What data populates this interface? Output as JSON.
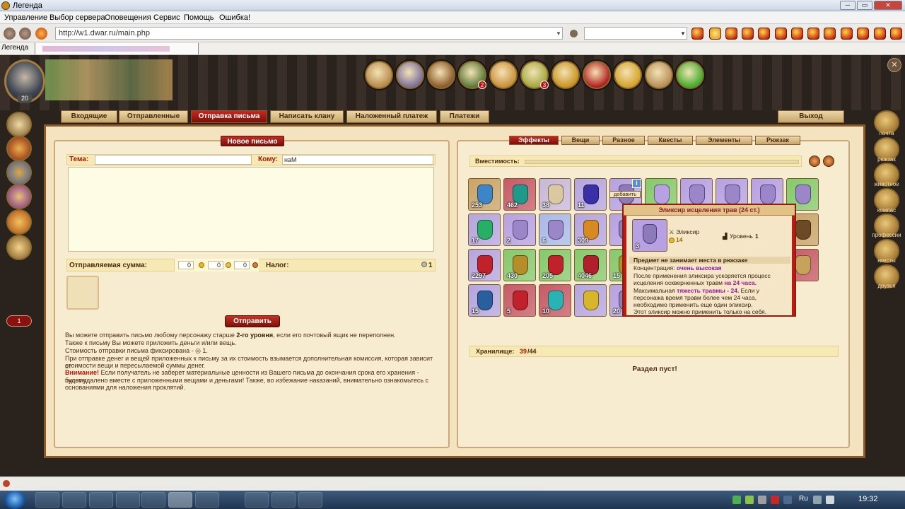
{
  "window": {
    "title": "Легенда",
    "controls": [
      "─",
      "▭",
      "✕"
    ]
  },
  "menu": [
    "Управление",
    "Выбор сервера",
    "Оповещения",
    "Сервис",
    "Помощь",
    "Ошибка!"
  ],
  "address": {
    "url": "http://w1.dwar.ru/main.php"
  },
  "browser_tab": {
    "label": "Легенда"
  },
  "hud": {
    "level": "20",
    "buttons": [
      {
        "name": "arena-icon",
        "color": "#b98a4c"
      },
      {
        "name": "castle-icon",
        "color": "#7b6f9e"
      },
      {
        "name": "bear-icon",
        "color": "#8c5b2b"
      },
      {
        "name": "warrior-icon",
        "color": "#5a7a3a",
        "badge": "2"
      },
      {
        "name": "amulet-icon",
        "color": "#c99038"
      },
      {
        "name": "map-icon",
        "color": "#a2a83e",
        "badge": "3"
      },
      {
        "name": "cards-icon",
        "color": "#c7941f"
      },
      {
        "name": "clan-emblem-icon",
        "color": "#b21e1e"
      },
      {
        "name": "gold-coins-icon",
        "color": "#d3a228"
      },
      {
        "name": "hammer-icon",
        "color": "#b88e5a"
      },
      {
        "name": "help-icon",
        "color": "#3fae2a"
      }
    ]
  },
  "right_sidebar": [
    "почта",
    "рюкзак",
    "животное",
    "компас",
    "профессии",
    "квесты",
    "друзья"
  ],
  "left_sidebar": {
    "badge": "1"
  },
  "mail_tabs": {
    "items": [
      "Входящие",
      "Отправленные",
      "Отправка письма",
      "Написать клану",
      "Наложенный платеж",
      "Платежи"
    ],
    "active": 2,
    "exit": "Выход"
  },
  "compose": {
    "header": "Новое письмо",
    "subject_label": "Тема:",
    "subject_value": "",
    "to_label": "Кому:",
    "to_value": "наМ",
    "amount_label": "Отправляемая сумма:",
    "amounts": [
      "0",
      "0",
      "0"
    ],
    "tax_label": "Налог:",
    "tax_value": "1",
    "send_button": "Отправить",
    "info": {
      "l1_pre": "Вы можете отправить письмо любому персонажу старше ",
      "l1_bold": "2-го уровня",
      "l1_post": ", если его почтовый ящик не переполнен.",
      "l2": "Также к письму Вы можете приложить деньги и/или вещь.",
      "l3": "Стоимость отправки письма фиксирована - ◎ 1.",
      "l4": "При отправке денег и вещей приложенных к письму за их стоимость взымается дополнительная комиссия, которая зависит от",
      "l5": "стоимости вещи и пересылаемой суммы денег.",
      "warn": "Внимание!",
      "l6": " Если получатель не заберет материальные ценности из Вашего письма до окончания срока его хранения - письмо",
      "l7": "будет удалено вместе с приложенными вещами и деньгами! Также, во избежание наказаний, внимательно ознакомьтесь с",
      "l8": "основаниями для наложения проклятий."
    }
  },
  "inventory": {
    "tabs": [
      "Эффекты",
      "Вещи",
      "Разное",
      "Квесты",
      "Элементы",
      "Рюкзак"
    ],
    "active": 0,
    "capacity_label": "Вместимость:",
    "storage_label": "Хранилище:",
    "storage_used": "39",
    "storage_total": "/44",
    "empty": "Раздел пуст!",
    "grid": [
      {
        "count": "253",
        "bg": "#c9a466",
        "fg": "#3d85c6"
      },
      {
        "count": "462",
        "bg": "#c75a66",
        "fg": "#1f9a8a"
      },
      {
        "count": "38",
        "bg": "#c9b8d8",
        "fg": "#d9c8a0"
      },
      {
        "count": "11",
        "bg": "#b5a5de",
        "fg": "#3b2fa8"
      },
      {
        "count": "",
        "bg": "#b7a1e2",
        "fg": "#8d7ab8"
      },
      {
        "count": "",
        "bg": "#86c96a",
        "fg": "#b7a1e2"
      },
      {
        "count": "",
        "bg": "#b7a1e2",
        "fg": "#9a86c8"
      },
      {
        "count": "",
        "bg": "#b7a1e2",
        "fg": "#9a86c8"
      },
      {
        "count": "",
        "bg": "#b7a1e2",
        "fg": "#9a86c8"
      },
      {
        "count": "",
        "bg": "#86c96a",
        "fg": "#9a86c8"
      },
      {
        "count": "17",
        "bg": "#b5a5de",
        "fg": "#27b065"
      },
      {
        "count": "2",
        "bg": "#b7a1e2",
        "fg": "#9a86c8"
      },
      {
        "count": "6",
        "bg": "#a9b9e8",
        "fg": "#9a86c8"
      },
      {
        "count": "309",
        "bg": "#b5a5de",
        "fg": "#d78a22"
      },
      {
        "count": "",
        "bg": "#b7a1e2",
        "fg": "#8d7ab8"
      },
      {
        "count": "",
        "bg": "#b7a1e2",
        "fg": "#8d7ab8"
      },
      {
        "count": "",
        "bg": "#b7a1e2",
        "fg": "#8d7ab8"
      },
      {
        "count": "",
        "bg": "#b7a1e2",
        "fg": "#8d7ab8"
      },
      {
        "count": "",
        "bg": "#b7a1e2",
        "fg": "#8d7ab8"
      },
      {
        "count": "",
        "bg": "#c9a466",
        "fg": "#6b4a25"
      },
      {
        "count": "2297",
        "bg": "#b5a5de",
        "fg": "#c0212b"
      },
      {
        "count": "430",
        "bg": "#86c96a",
        "fg": "#b58e2a"
      },
      {
        "count": "205",
        "bg": "#86c96a",
        "fg": "#c0212b"
      },
      {
        "count": "4046",
        "bg": "#86c96a",
        "fg": "#b01f2b"
      },
      {
        "count": "15",
        "bg": "#86c96a",
        "fg": "#b58e2a"
      },
      {
        "count": "",
        "bg": "#b7a1e2",
        "fg": "#8d7ab8"
      },
      {
        "count": "",
        "bg": "#b7a1e2",
        "fg": "#8d7ab8"
      },
      {
        "count": "",
        "bg": "#b7a1e2",
        "fg": "#8d7ab8"
      },
      {
        "count": "",
        "bg": "#b7a1e2",
        "fg": "#8d7ab8"
      },
      {
        "count": "",
        "bg": "#c75a66",
        "fg": "#c7a25a"
      },
      {
        "count": "15",
        "bg": "#b5a5de",
        "fg": "#2a5f9e"
      },
      {
        "count": "5",
        "bg": "#c75a66",
        "fg": "#c0212b"
      },
      {
        "count": "10",
        "bg": "#c75a66",
        "fg": "#2ab3b3"
      },
      {
        "count": "",
        "bg": "#b5a5de",
        "fg": "#d8b52a"
      },
      {
        "count": "20",
        "bg": "#b7a1e2",
        "fg": "#8d7ab8"
      }
    ]
  },
  "tooltip": {
    "hover_label": "добавить",
    "title": "Эликсир исцеления трав (24 ст.)",
    "count": "3",
    "type": "Эликсир",
    "level_label": "Уровень",
    "level_value": "1",
    "price": "14",
    "no_space": "Предмет не занимает места в рюкзаке",
    "conc_label": "Концентрация: ",
    "conc_value": "очень высокая",
    "d1": "После применения эликсира ускоряется процесс",
    "d2_pre": "исцеления оскверненных травм ",
    "d2_hl": "на 24 часа.",
    "d3_pre": "Максимальная ",
    "d3_hl": "тяжесть травмы - 24.",
    "d3_post": " Если у",
    "d4": "персонажа время травм более чем 24 часа,",
    "d5": "необходимо применить еще один эликсир.",
    "d6": "Этот эликсир можно применить только на себя."
  },
  "taskbar": {
    "clock": "19:32",
    "tray_lang": "Ru"
  },
  "colors": {
    "parchment": "#f3e4bf",
    "accent_red": "#c4291f",
    "frame_brown": "#8b5a2b"
  }
}
